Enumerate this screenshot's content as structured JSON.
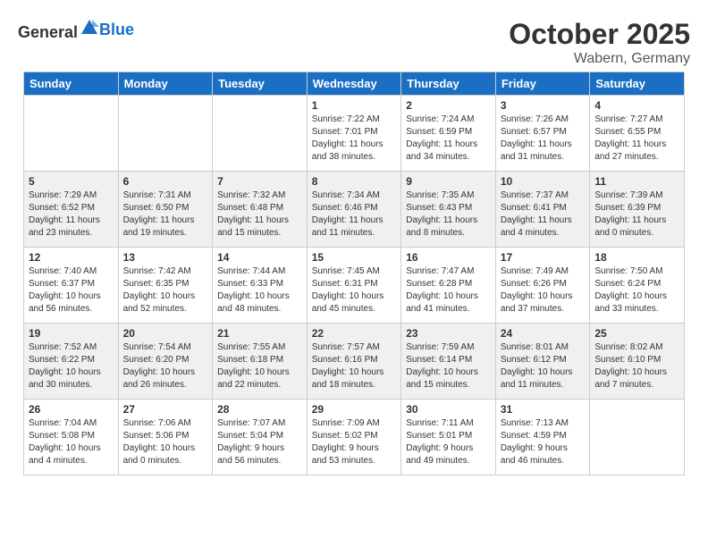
{
  "header": {
    "logo_general": "General",
    "logo_blue": "Blue",
    "month": "October 2025",
    "location": "Wabern, Germany"
  },
  "days_of_week": [
    "Sunday",
    "Monday",
    "Tuesday",
    "Wednesday",
    "Thursday",
    "Friday",
    "Saturday"
  ],
  "weeks": [
    {
      "shaded": false,
      "days": [
        {
          "number": "",
          "info": ""
        },
        {
          "number": "",
          "info": ""
        },
        {
          "number": "",
          "info": ""
        },
        {
          "number": "1",
          "info": "Sunrise: 7:22 AM\nSunset: 7:01 PM\nDaylight: 11 hours\nand 38 minutes."
        },
        {
          "number": "2",
          "info": "Sunrise: 7:24 AM\nSunset: 6:59 PM\nDaylight: 11 hours\nand 34 minutes."
        },
        {
          "number": "3",
          "info": "Sunrise: 7:26 AM\nSunset: 6:57 PM\nDaylight: 11 hours\nand 31 minutes."
        },
        {
          "number": "4",
          "info": "Sunrise: 7:27 AM\nSunset: 6:55 PM\nDaylight: 11 hours\nand 27 minutes."
        }
      ]
    },
    {
      "shaded": true,
      "days": [
        {
          "number": "5",
          "info": "Sunrise: 7:29 AM\nSunset: 6:52 PM\nDaylight: 11 hours\nand 23 minutes."
        },
        {
          "number": "6",
          "info": "Sunrise: 7:31 AM\nSunset: 6:50 PM\nDaylight: 11 hours\nand 19 minutes."
        },
        {
          "number": "7",
          "info": "Sunrise: 7:32 AM\nSunset: 6:48 PM\nDaylight: 11 hours\nand 15 minutes."
        },
        {
          "number": "8",
          "info": "Sunrise: 7:34 AM\nSunset: 6:46 PM\nDaylight: 11 hours\nand 11 minutes."
        },
        {
          "number": "9",
          "info": "Sunrise: 7:35 AM\nSunset: 6:43 PM\nDaylight: 11 hours\nand 8 minutes."
        },
        {
          "number": "10",
          "info": "Sunrise: 7:37 AM\nSunset: 6:41 PM\nDaylight: 11 hours\nand 4 minutes."
        },
        {
          "number": "11",
          "info": "Sunrise: 7:39 AM\nSunset: 6:39 PM\nDaylight: 11 hours\nand 0 minutes."
        }
      ]
    },
    {
      "shaded": false,
      "days": [
        {
          "number": "12",
          "info": "Sunrise: 7:40 AM\nSunset: 6:37 PM\nDaylight: 10 hours\nand 56 minutes."
        },
        {
          "number": "13",
          "info": "Sunrise: 7:42 AM\nSunset: 6:35 PM\nDaylight: 10 hours\nand 52 minutes."
        },
        {
          "number": "14",
          "info": "Sunrise: 7:44 AM\nSunset: 6:33 PM\nDaylight: 10 hours\nand 48 minutes."
        },
        {
          "number": "15",
          "info": "Sunrise: 7:45 AM\nSunset: 6:31 PM\nDaylight: 10 hours\nand 45 minutes."
        },
        {
          "number": "16",
          "info": "Sunrise: 7:47 AM\nSunset: 6:28 PM\nDaylight: 10 hours\nand 41 minutes."
        },
        {
          "number": "17",
          "info": "Sunrise: 7:49 AM\nSunset: 6:26 PM\nDaylight: 10 hours\nand 37 minutes."
        },
        {
          "number": "18",
          "info": "Sunrise: 7:50 AM\nSunset: 6:24 PM\nDaylight: 10 hours\nand 33 minutes."
        }
      ]
    },
    {
      "shaded": true,
      "days": [
        {
          "number": "19",
          "info": "Sunrise: 7:52 AM\nSunset: 6:22 PM\nDaylight: 10 hours\nand 30 minutes."
        },
        {
          "number": "20",
          "info": "Sunrise: 7:54 AM\nSunset: 6:20 PM\nDaylight: 10 hours\nand 26 minutes."
        },
        {
          "number": "21",
          "info": "Sunrise: 7:55 AM\nSunset: 6:18 PM\nDaylight: 10 hours\nand 22 minutes."
        },
        {
          "number": "22",
          "info": "Sunrise: 7:57 AM\nSunset: 6:16 PM\nDaylight: 10 hours\nand 18 minutes."
        },
        {
          "number": "23",
          "info": "Sunrise: 7:59 AM\nSunset: 6:14 PM\nDaylight: 10 hours\nand 15 minutes."
        },
        {
          "number": "24",
          "info": "Sunrise: 8:01 AM\nSunset: 6:12 PM\nDaylight: 10 hours\nand 11 minutes."
        },
        {
          "number": "25",
          "info": "Sunrise: 8:02 AM\nSunset: 6:10 PM\nDaylight: 10 hours\nand 7 minutes."
        }
      ]
    },
    {
      "shaded": false,
      "days": [
        {
          "number": "26",
          "info": "Sunrise: 7:04 AM\nSunset: 5:08 PM\nDaylight: 10 hours\nand 4 minutes."
        },
        {
          "number": "27",
          "info": "Sunrise: 7:06 AM\nSunset: 5:06 PM\nDaylight: 10 hours\nand 0 minutes."
        },
        {
          "number": "28",
          "info": "Sunrise: 7:07 AM\nSunset: 5:04 PM\nDaylight: 9 hours\nand 56 minutes."
        },
        {
          "number": "29",
          "info": "Sunrise: 7:09 AM\nSunset: 5:02 PM\nDaylight: 9 hours\nand 53 minutes."
        },
        {
          "number": "30",
          "info": "Sunrise: 7:11 AM\nSunset: 5:01 PM\nDaylight: 9 hours\nand 49 minutes."
        },
        {
          "number": "31",
          "info": "Sunrise: 7:13 AM\nSunset: 4:59 PM\nDaylight: 9 hours\nand 46 minutes."
        },
        {
          "number": "",
          "info": ""
        }
      ]
    }
  ]
}
